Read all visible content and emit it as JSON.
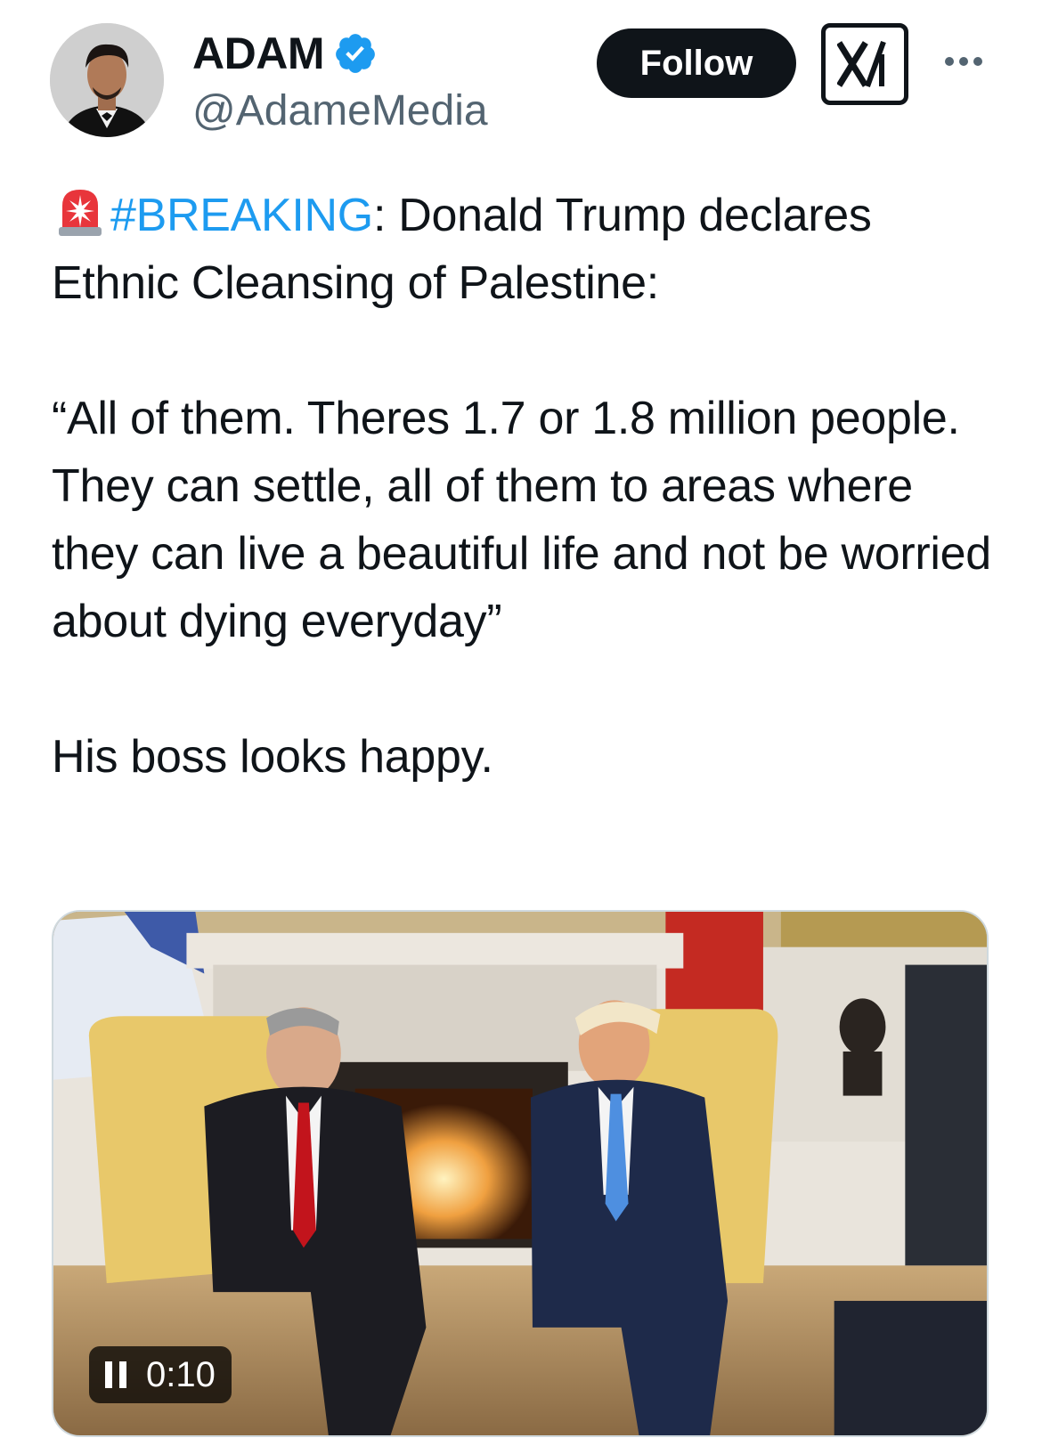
{
  "author": {
    "display_name": "ADAM",
    "handle": "@AdameMedia",
    "verified": true,
    "avatar_icon": "profile-photo"
  },
  "actions": {
    "follow_label": "Follow",
    "grok_icon": "grok-icon",
    "more_icon": "more-icon"
  },
  "tweet": {
    "emoji_icon": "rotating-light-icon",
    "hashtag": "#BREAKING",
    "headline_rest": ": Donald Trump declares Ethnic Cleansing of Palestine:",
    "quote": "“All of them. Theres 1.7 or 1.8 million people. They can settle, all of them to areas where they can live a beautiful life and not be worried about dying everyday”",
    "comment": "His boss looks happy."
  },
  "media": {
    "type": "video",
    "time": "0:10",
    "state_icon": "pause-icon"
  },
  "colors": {
    "link": "#1d9bf0",
    "verified": "#1d9bf0",
    "text": "#0f1419",
    "secondary": "#536471"
  }
}
